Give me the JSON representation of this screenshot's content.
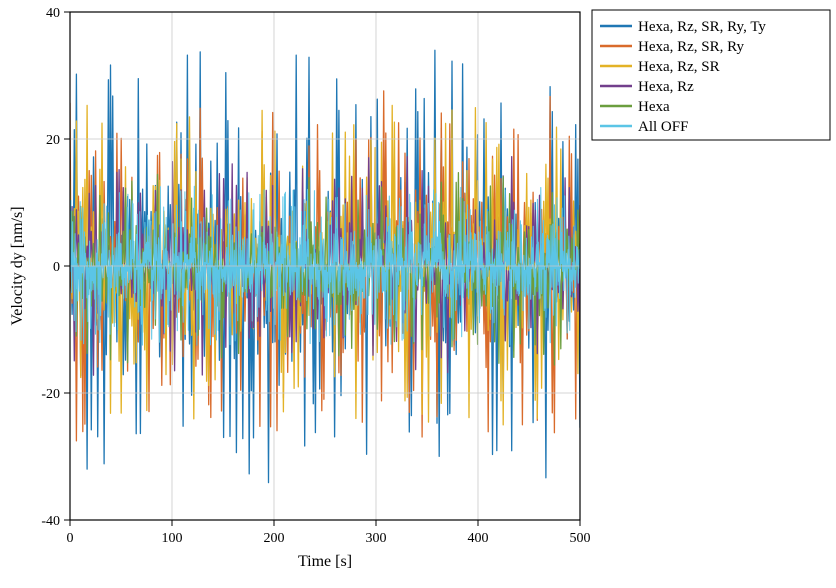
{
  "chart_data": {
    "type": "line",
    "title": "",
    "xlabel": "Time [s]",
    "ylabel": "Velocity dy [nm/s]",
    "xlim": [
      0,
      500
    ],
    "ylim": [
      -40,
      40
    ],
    "x_ticks": [
      0,
      100,
      200,
      300,
      400,
      500
    ],
    "y_ticks": [
      -40,
      -20,
      0,
      20,
      40
    ],
    "grid": true,
    "legend_position": "upper-right-outside",
    "series": [
      {
        "name": "Hexa, Rz, SR, Ry, Ty",
        "color": "#1f77b4",
        "amplitude": 30,
        "spikes": 240
      },
      {
        "name": "Hexa, Rz, SR, Ry",
        "color": "#d96b2b",
        "amplitude": 24,
        "spikes": 240
      },
      {
        "name": "Hexa, Rz, SR",
        "color": "#e3b226",
        "amplitude": 22,
        "spikes": 240
      },
      {
        "name": "Hexa, Rz",
        "color": "#723f8c",
        "amplitude": 15,
        "spikes": 240
      },
      {
        "name": "Hexa",
        "color": "#6b9e3e",
        "amplitude": 14,
        "spikes": 240
      },
      {
        "name": "All OFF",
        "color": "#5bc5e6",
        "amplitude": 11,
        "spikes": 600
      }
    ],
    "note": "Series are dense noisy velocity traces over 0–500 s; amplitudes listed are visually-estimated peak magnitudes in nm/s with all series roughly zero-mean."
  },
  "legend": {
    "items": [
      {
        "label": "Hexa, Rz, SR, Ry, Ty",
        "color": "#1f77b4"
      },
      {
        "label": "Hexa, Rz, SR, Ry",
        "color": "#d96b2b"
      },
      {
        "label": "Hexa, Rz, SR",
        "color": "#e3b226"
      },
      {
        "label": "Hexa, Rz",
        "color": "#723f8c"
      },
      {
        "label": "Hexa",
        "color": "#6b9e3e"
      },
      {
        "label": "All OFF",
        "color": "#5bc5e6"
      }
    ]
  },
  "axes": {
    "xlabel": "Time [s]",
    "ylabel": "Velocity dy [nm/s]",
    "xticks": [
      "0",
      "100",
      "200",
      "300",
      "400",
      "500"
    ],
    "yticks": [
      "-40",
      "-20",
      "0",
      "20",
      "40"
    ]
  }
}
